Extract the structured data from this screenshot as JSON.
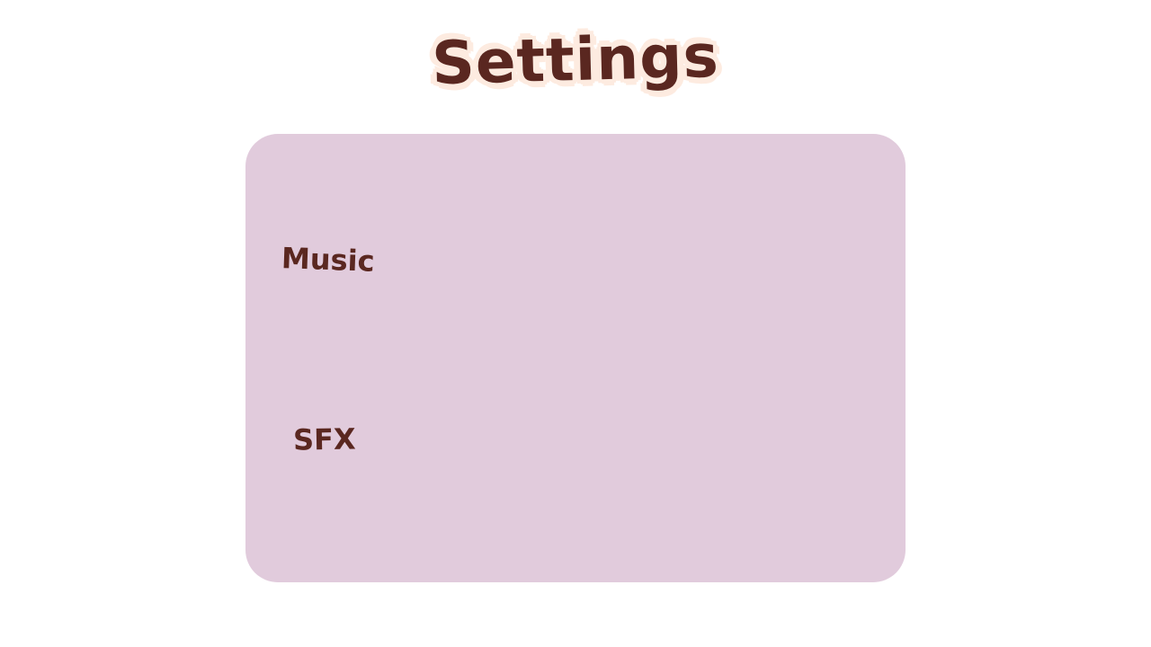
{
  "title": "Settings",
  "settings_panel": {
    "music_label": "Music",
    "sfx_label": "SFX"
  },
  "colors": {
    "background": "#ffffff",
    "panel": "#e1cbdc",
    "text": "#5a2720",
    "title_outline": "#fdebe0"
  }
}
